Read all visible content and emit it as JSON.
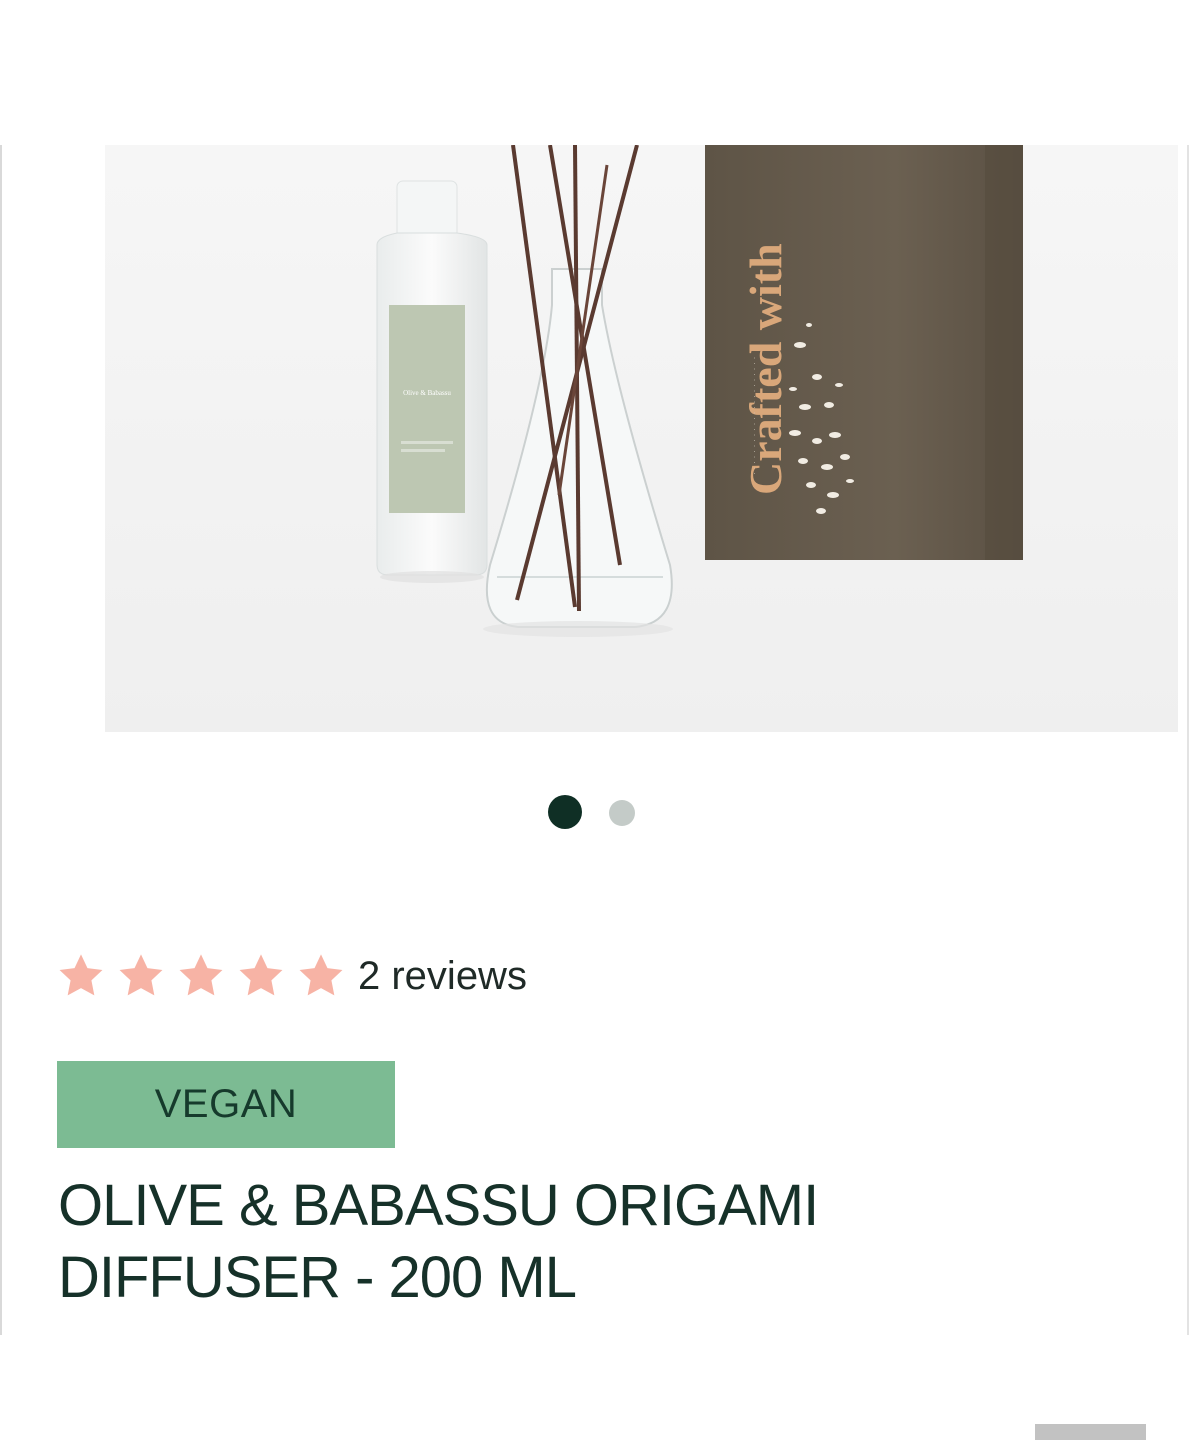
{
  "product": {
    "image_alt": "Olive & Babassu Origami Diffuser with refill bottle, glass flask with reeds and gift box",
    "box_text": "Crafted with",
    "bottle_label": "Olive & Babassu",
    "rating": {
      "stars": 5,
      "max_stars": 5,
      "reviews_label": "2 reviews",
      "star_color": "#f7b3a5"
    },
    "badge": {
      "label": "VEGAN",
      "color": "#7cbb93"
    },
    "title": "OLIVE & BABASSU ORIGAMI DIFFUSER - 200 ML"
  },
  "carousel": {
    "active_index": 0,
    "count": 2
  },
  "colors": {
    "dot_active": "#0f2f25",
    "dot_inactive": "#c4cbc8",
    "title_text": "#163129"
  }
}
